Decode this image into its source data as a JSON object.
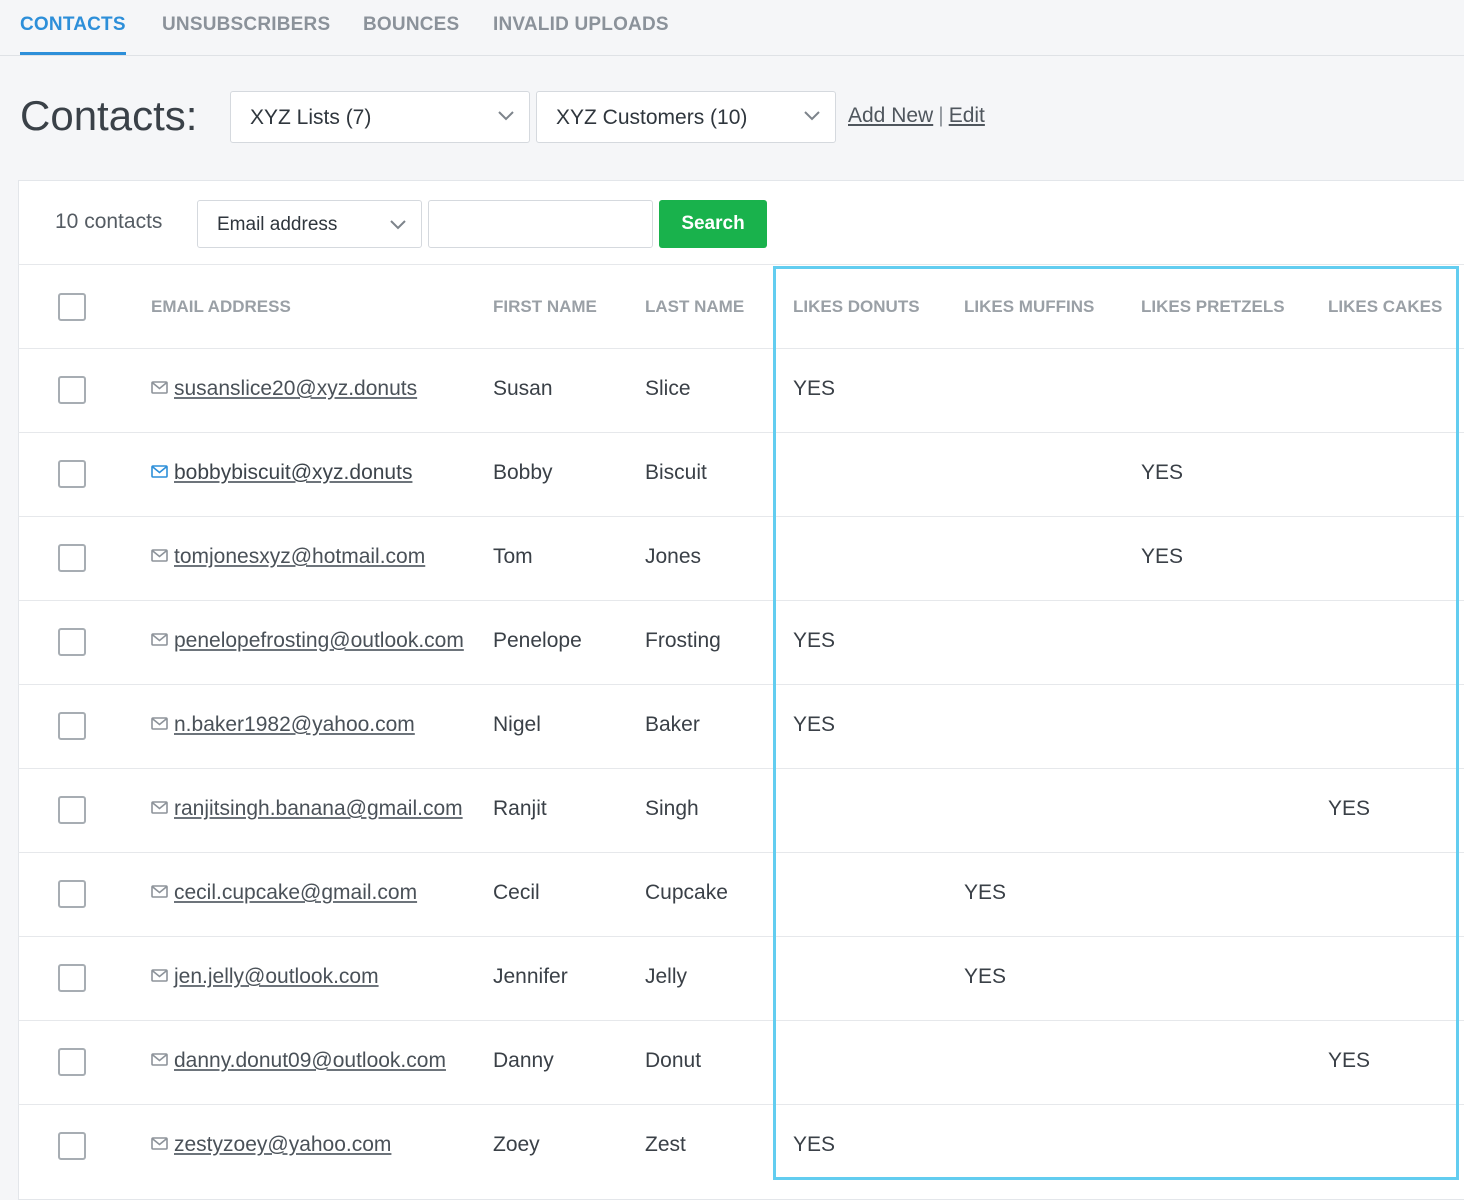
{
  "tabs": [
    {
      "label": "CONTACTS",
      "active": true
    },
    {
      "label": "UNSUBSCRIBERS",
      "active": false
    },
    {
      "label": "BOUNCES",
      "active": false
    },
    {
      "label": "INVALID UPLOADS",
      "active": false
    }
  ],
  "header": {
    "title": "Contacts:",
    "list_select": "XYZ Lists (7)",
    "segment_select": "XYZ Customers (10)",
    "add_new": "Add New",
    "separator": "|",
    "edit": "Edit"
  },
  "toolbar": {
    "count": "10 contacts",
    "field_select": "Email address",
    "search_value": "",
    "search_label": "Search"
  },
  "columns": [
    "EMAIL ADDRESS",
    "FIRST NAME",
    "LAST NAME",
    "LIKES DONUTS",
    "LIKES MUFFINS",
    "LIKES PRETZELS",
    "LIKES CAKES"
  ],
  "rows": [
    {
      "email": "susanslice20@xyz.donuts",
      "first": "Susan",
      "last": "Slice",
      "donuts": "YES",
      "muffins": "",
      "pretzels": "",
      "cakes": ""
    },
    {
      "email": "bobbybiscuit@xyz.donuts",
      "first": "Bobby",
      "last": "Biscuit",
      "donuts": "",
      "muffins": "",
      "pretzels": "YES",
      "cakes": ""
    },
    {
      "email": "tomjonesxyz@hotmail.com",
      "first": "Tom",
      "last": "Jones",
      "donuts": "",
      "muffins": "",
      "pretzels": "YES",
      "cakes": ""
    },
    {
      "email": "penelopefrosting@outlook.com",
      "first": "Penelope",
      "last": "Frosting",
      "donuts": "YES",
      "muffins": "",
      "pretzels": "",
      "cakes": ""
    },
    {
      "email": "n.baker1982@yahoo.com",
      "first": "Nigel",
      "last": "Baker",
      "donuts": "YES",
      "muffins": "",
      "pretzels": "",
      "cakes": ""
    },
    {
      "email": "ranjitsingh.banana@gmail.com",
      "first": "Ranjit",
      "last": "Singh",
      "donuts": "",
      "muffins": "",
      "pretzels": "",
      "cakes": "YES"
    },
    {
      "email": "cecil.cupcake@gmail.com",
      "first": "Cecil",
      "last": "Cupcake",
      "donuts": "",
      "muffins": "YES",
      "pretzels": "",
      "cakes": ""
    },
    {
      "email": "jen.jelly@outlook.com",
      "first": "Jennifer",
      "last": "Jelly",
      "donuts": "",
      "muffins": "YES",
      "pretzels": "",
      "cakes": ""
    },
    {
      "email": "danny.donut09@outlook.com",
      "first": "Danny",
      "last": "Donut",
      "donuts": "",
      "muffins": "",
      "pretzels": "",
      "cakes": "YES"
    },
    {
      "email": "zestyzoey@yahoo.com",
      "first": "Zoey",
      "last": "Zest",
      "donuts": "YES",
      "muffins": "",
      "pretzels": "",
      "cakes": ""
    }
  ],
  "icons": {
    "mail": "mail-icon",
    "chevron": "chevron-down-icon"
  },
  "colors": {
    "accent": "#2d8fd9",
    "search_button": "#19b24c",
    "highlight_border": "#62cdf0",
    "hover_mail_icon": "#2d8fd9"
  }
}
